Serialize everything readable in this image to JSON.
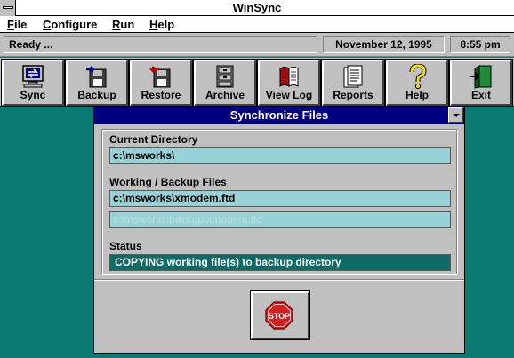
{
  "app": {
    "title": "WinSync"
  },
  "menu": [
    {
      "acc": "F",
      "rest": "ile"
    },
    {
      "acc": "C",
      "rest": "onfigure"
    },
    {
      "acc": "R",
      "rest": "un"
    },
    {
      "acc": "H",
      "rest": "elp"
    }
  ],
  "status": {
    "message": "Ready ...",
    "date": "November 12, 1995",
    "time": "8:55 pm"
  },
  "toolbar": [
    {
      "label": "Sync",
      "icon": "sync-icon"
    },
    {
      "label": "Backup",
      "icon": "backup-icon"
    },
    {
      "label": "Restore",
      "icon": "restore-icon"
    },
    {
      "label": "Archive",
      "icon": "archive-icon"
    },
    {
      "label": "View Log",
      "icon": "view-log-icon"
    },
    {
      "label": "Reports",
      "icon": "reports-icon"
    },
    {
      "label": "Help",
      "icon": "help-icon"
    },
    {
      "label": "Exit",
      "icon": "exit-icon"
    }
  ],
  "dialog": {
    "title": "Synchronize Files",
    "current_dir_label": "Current Directory",
    "current_dir_value": "c:\\msworks\\",
    "working_label": "Working / Backup Files",
    "working_value": "c:\\msworks\\xmodem.ftd",
    "backup_value": "c:\\msworks\\backup\\xmodem.ftd",
    "status_label": "Status",
    "status_value": "COPYING working file(s) to backup directory",
    "stop_label": "STOP"
  },
  "colors": {
    "desktop": "#0b7a73",
    "titlebar_active": "#000080",
    "field_fill": "#96d2d6",
    "status_fill": "#0e6b67",
    "stop_red": "#d42020"
  }
}
